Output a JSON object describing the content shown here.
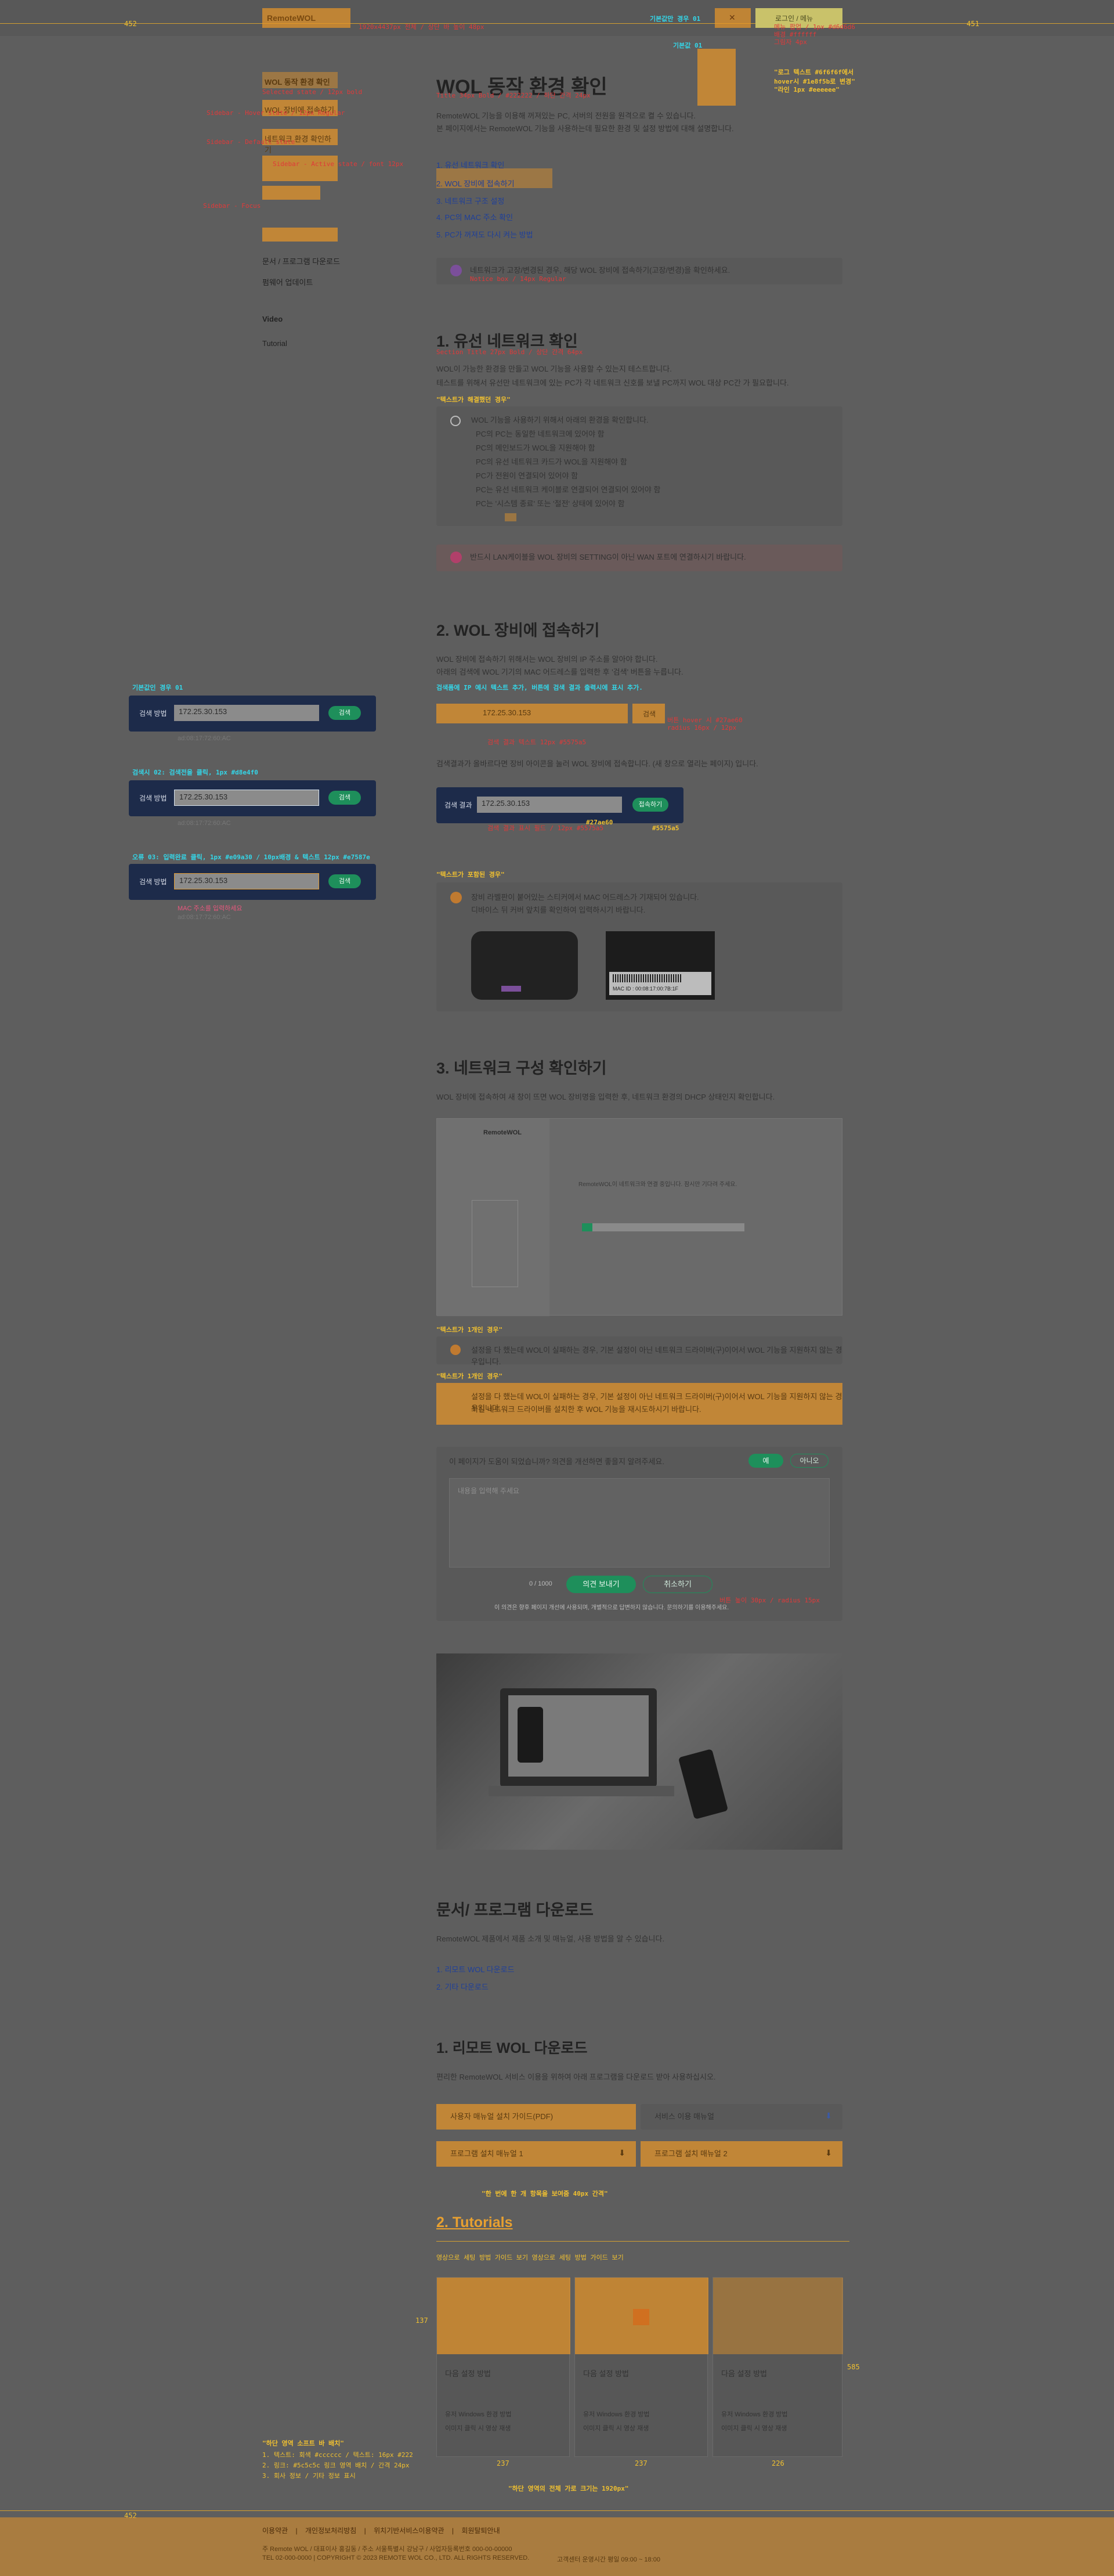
{
  "header": {
    "logo_text": "RemoteWOL",
    "ann_top": "1920x4437px 전체 / 상단 바 높이 48px",
    "ann_right_label": "기본값만 경우 01",
    "btn_x": "✕",
    "btn_right": "로그인 / 메뉴",
    "right_label_small": "로그인 /",
    "dim_left": "452",
    "dim_right": "451"
  },
  "colors": {
    "accent": "#1e8f5b",
    "navy": "#1d2b4a",
    "overlay": "#e89628",
    "annotation_red": "#e03a3a",
    "annotation_cyan": "#34d6e8"
  },
  "sidebar": {
    "items": [
      {
        "label": "WOL 동작 환경 확인"
      },
      {
        "label": "WOL 장비에 접속하기"
      },
      {
        "label": "네트워크 환경 확인하기"
      },
      {
        "label": "문서 / 프로그램 다운로드"
      },
      {
        "label": "펌웨어 업데이트"
      },
      {
        "label": "Video"
      },
      {
        "label": "Tutorial"
      }
    ],
    "ann1": "Selected state / 12px bold",
    "ann2": "Sidebar - Hover state / 12px Regular",
    "ann3": "Sidebar - Default state",
    "ann4": "Sidebar - Active state / font 12px",
    "ann5": "Sidebar - Focus"
  },
  "section1": {
    "title": "WOL 동작 환경 확인",
    "intro1": "RemoteWOL 기능을 이용해 꺼져있는 PC, 서버의 전원을 원격으로 켤 수 있습니다.",
    "intro2": "본 페이지에서는 RemoteWOL 기능을 사용하는데 필요한 환경 및 설정 방법에 대해 설명합니다.",
    "toc": [
      "1. 유선 네트워크 확인",
      "2. WOL 장비에 접속하기",
      "3. 네트워크 구조 설정",
      "4. PC의 MAC 주소 확인",
      "5. PC가 꺼져도 다시 켜는 방법"
    ],
    "notice": "네트워크가 고장/변경된 경우, 해당 WOL 장비에 접속하기(고장/변경)을 확인하세요.",
    "notice_ann": "Notice box / 14px Regular"
  },
  "section_wired": {
    "title": "1. 유선 네트워크 확인",
    "p1": "WOL이 가능한 환경을 만들고 WOL 기능을 사용할 수 있는지 테스트합니다.",
    "p2": "테스트를 위해서 유선만 네트워크에 있는 PC가 각 네트워크 신호를 보낼 PC까지 WOL 대상 PC간 가 필요합니다.",
    "tip_label": "\"텍스트가 해결했던 경우\"",
    "check_intro": "WOL 기능을 사용하기 위해서 아래의 환경을 확인합니다.",
    "checks": [
      "PC의 PC는 동일한 네트워크에 있어야 함",
      "PC의 메인보드가 WOL을 지원해야 함",
      "PC의 유선 네트워크 카드가 WOL을 지원해야 함",
      "PC가 전원이 연결되어 있어야 함",
      "PC는 유선 네트워크 케이블로 연결되어 연결되어 있어야 함",
      "PC는 '시스템 종료' 또는 '절전' 상태에 있어야 함"
    ],
    "warning": "반드시 LAN케이블을 WOL 장비의 SETTING이 아닌 WAN 포트에 연결하시기 바랍니다."
  },
  "section_access": {
    "title": "2. WOL 장비에 접속하기",
    "p1": "WOL 장비에 접속하기 위해서는 WOL 장비의 IP 주소를 알아야 합니다.",
    "p2": "아래의 검색에 WOL 기기의 MAC 어드레스를 입력한 후 '검색' 버튼을 누릅니다.",
    "ann_top": "검색폼에 IP 예시 텍스트 추가, 버튼에 검색 결과 출력시에 표시 추가.",
    "search_label": "검색 방법",
    "search_value": "172.25.30.153",
    "search_btn": "검색",
    "search_mac": "ad:08:17:72:60:AC",
    "p3": "검색결과가 올바르다면 장비 아이콘을 눌러 WOL 장비에 접속합니다. (새 창으로 열리는 페이지) 입니다.",
    "form2_label": "검색 결과",
    "form2_value": "172.25.30.153",
    "form2_btn": "접속하기",
    "form2_ann1": "#27ae60",
    "form2_ann2": "#5575a5",
    "tip_label": "\"텍스트가 포함된 경우\"",
    "tip_text1": "장비 라벨판이 붙어있는 스티커에서 MAC 어드레스가 기재되어 있습니다.",
    "tip_text2": "디바이스 뒤 커버 앞치를 확인하여 입력하시기 바랍니다.",
    "label_mac": "MAC ID : 00:08:17:00:7B:1F",
    "left_ann1": "기본값인 경우 01",
    "left_ann2": "검색시 02: 검색전을 클릭, 1px #d8e4f0",
    "left_ann3": "오류 03: 입력완료 클릭, 1px #e09a30 / 10px배경 & 텍스트 12px #e7587e",
    "left_forms": [
      {
        "label": "검색 방법",
        "value": "172.25.30.153",
        "btn": "검색",
        "mac": "ad:08:17:72:60:AC"
      },
      {
        "label": "검색 방법",
        "value": "172.25.30.153",
        "btn": "검색",
        "mac": "ad:08:17:72:60:AC"
      },
      {
        "label": "검색 방법",
        "value": "172.25.30.153",
        "btn": "검색",
        "mac": "ad:08:17:72:60:AC",
        "error": "MAC 주소를 입력하세요"
      }
    ]
  },
  "section_network": {
    "title": "3. 네트워크 구성 확인하기",
    "p1": "WOL 장비에 접속하여 새 창이 뜨면 WOL 장비명을 입력한 후, 네트워크 환경의 DHCP 상태인지 확인합니다.",
    "shot_logo": "RemoteWOL",
    "shot_text": "RemoteWOL이 네트워크와 연결 중입니다. 잠시만 기다려 주세요.",
    "tip1_label": "\"텍스트가 1개인 경우\"",
    "tip1_text": "설정을 다 했는데 WOL이 실패하는 경우, 기본 설정이 아닌 네트워크 드라이버(구)이어서 WOL 기능을 지원하지 않는 경우입니다.",
    "tip2_label": "\"텍스트가 1개인 경우\"",
    "tip2_text1": "설정을 다 했는데 WOL이 실패하는 경우, 기본 설정이 아닌 네트워크 드라이버(구)이어서 WOL 기능을 지원하지 않는 경우입니다.",
    "tip2_text2": "최신 네트워크 드라이버를 설치한 후 WOL 기능을 재시도하시기 바랍니다."
  },
  "feedback": {
    "question": "이 페이지가 도움이 되었습니까? 의견을 개선하면 좋을지 알려주세요.",
    "yes": "예",
    "no": "아니오",
    "placeholder": "내용을 입력해 주세요",
    "count": "0 / 1000",
    "submit": "의견 보내기",
    "cancel": "취소하기",
    "note": "이 의견은 향후 페이지 개선에 사용되며, 개별적으로 답변하지 않습니다. 문의하기를 이용해주세요."
  },
  "downloads": {
    "title": "문서/ 프로그램 다운로드",
    "p1": "RemoteWOL 제품에서 제품 소개 및 매뉴얼, 사용 방법을 알 수 있습니다.",
    "links": [
      "1. 리모트 WOL 다운로드",
      "2. 기타 다운로드"
    ],
    "sub_title": "1. 리모트 WOL 다운로드",
    "sub_p": "편리한 RemoteWOL 서비스 이용을 위하여 아래 프로그램을 다운로드 받아 사용하십시오.",
    "files": [
      {
        "label": "사용자 매뉴얼 설치 가이드(PDF)"
      },
      {
        "label": "서비스 이용 매뉴얼"
      },
      {
        "label": "프로그램 설치 매뉴얼 1"
      },
      {
        "label": "프로그램 설치 매뉴얼 2"
      }
    ],
    "ann_dl": "\"한 번에 한 개 항목을 보여줌 40px 간격\"",
    "tutorials_title": "2. Tutorials",
    "tutorials_ann": "영상으로 세팅 방법 가이드 보기 영상으로 세팅 방법 가이드 보기",
    "cards": [
      {
        "title": "다음 설정 방법",
        "desc1": "유저 Windows 환경 방법",
        "desc2": "이미지 클릭 시 영상 재생"
      },
      {
        "title": "다음 설정 방법",
        "desc1": "유저 Windows 환경 방법",
        "desc2": "이미지 클릭 시 영상 재생"
      },
      {
        "title": "다음 설정 방법",
        "desc1": "유저 Windows 환경 방법",
        "desc2": "이미지 클릭 시 영상 재생"
      }
    ],
    "card_dims": [
      "237",
      "237",
      "226"
    ],
    "card_height": "585",
    "card_top": "137"
  },
  "notes_bottom": {
    "ann_left": "\"하단 영역 소프트 바 배치\"",
    "line1": "1. 텍스트: 회색 #cccccc / 텍스트: 16px #222",
    "line2": "2. 링크: #5c5c5c 링크 영역 배치 / 간격 24px",
    "line3": "3. 회사 정보 / 기타 정보 표시",
    "ann_right": "\"하단 영역의 전체 가로 크기는 1920px\""
  },
  "footer": {
    "links": [
      "이용약관",
      "개인정보처리방침",
      "위치기반서비스이용약관",
      "회원탈퇴안내"
    ],
    "line1": "주 Remote WOL / 대표이사 홍길동 / 주소 서울특별시 강남구 / 사업자등록번호 000-00-00000",
    "copyright": "TEL 02-000-0000 | COPYRIGHT © 2023 REMOTE WOL CO., LTD. ALL RIGHTS RESERVED.",
    "dim": "452",
    "right_text": "고객센터 운영시간 평일 09:00 ~ 18:00"
  }
}
